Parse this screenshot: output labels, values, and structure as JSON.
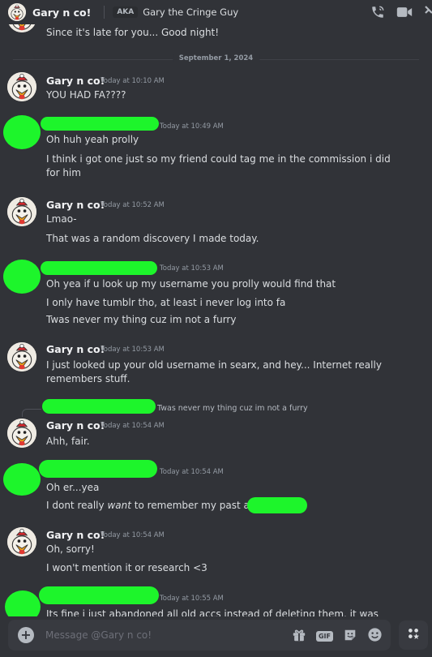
{
  "header": {
    "name": "Gary n co!",
    "aka_badge": "AKA",
    "alias": "Gary the Cringe Guy"
  },
  "messages": {
    "prev_line": "Since it's late for you... Good night!",
    "date_divider": "September 1, 2024",
    "g1": {
      "author": "Gary n co!",
      "time": "Today at 10:10 AM",
      "lines": [
        "YOU HAD FA????"
      ]
    },
    "u1": {
      "time": "Today at 10:49 AM",
      "lines": [
        "Oh huh yeah prolly",
        "I think i got one just so my friend could tag me in the commission i did for him"
      ]
    },
    "g2": {
      "author": "Gary n co!",
      "time": "Today at 10:52 AM",
      "lines": [
        "Lmao-",
        "That was a random discovery I made today."
      ]
    },
    "u2": {
      "time": "Today at 10:53 AM",
      "lines": [
        "Oh yea if u look up my username you prolly would find that",
        "I only have tumblr tho, at least i never log into fa",
        "Twas never my thing cuz im not a furry"
      ]
    },
    "g3": {
      "author": "Gary n co!",
      "time": "Today at 10:53 AM",
      "lines": [
        "I just looked up your old username in searx, and hey... Internet really remembers stuff."
      ]
    },
    "reply_preview": "Twas never my thing cuz im not a furry",
    "g4": {
      "author": "Gary n co!",
      "time": "Today at 10:54 AM",
      "lines": [
        "Ahh, fair."
      ]
    },
    "u3": {
      "time": "Today at 10:54 AM",
      "line1": "Oh er...yea",
      "line2_pre": "I dont really ",
      "line2_em": "want",
      "line2_post": " to remember my past as"
    },
    "g5": {
      "author": "Gary n co!",
      "time": "Today at 10:54 AM",
      "lines": [
        "Oh, sorry!",
        "I won't mention it or research <3"
      ]
    },
    "u4": {
      "time": "Today at 10:55 AM",
      "lines": [
        "Its fine i just abandoned all old accs instead of deleting them, it was"
      ]
    }
  },
  "composer": {
    "placeholder": "Message @Gary n co!",
    "gif_label": "GIF"
  },
  "colors": {
    "background": "#313338",
    "redaction": "#1df52b",
    "text": "#dbdee1",
    "muted": "#949ba4"
  },
  "icons": [
    "avatar-chicken",
    "call-icon",
    "video-icon",
    "pin-icon",
    "plus-icon",
    "gift-icon",
    "gif-icon",
    "sticker-icon",
    "emoji-icon",
    "apps-icon"
  ]
}
